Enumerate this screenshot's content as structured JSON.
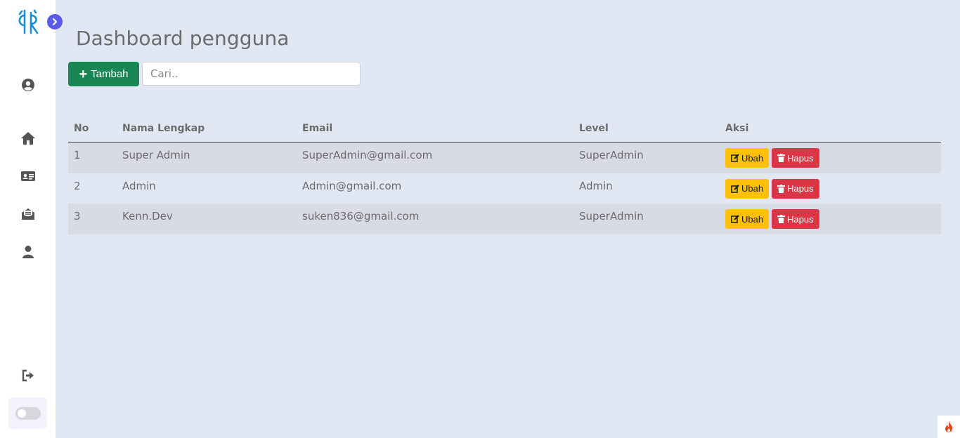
{
  "page": {
    "title": "Dashboard pengguna"
  },
  "toolbar": {
    "add_label": "Tambah",
    "search_placeholder": "Cari.."
  },
  "table": {
    "headers": {
      "no": "No",
      "name": "Nama Lengkap",
      "email": "Email",
      "level": "Level",
      "action": "Aksi"
    },
    "rows": [
      {
        "no": "1",
        "name": "Super Admin",
        "email": "SuperAdmin@gmail.com",
        "level": "SuperAdmin",
        "edit": "Ubah",
        "delete": "Hapus"
      },
      {
        "no": "2",
        "name": "Admin",
        "email": "Admin@gmail.com",
        "level": "Admin",
        "edit": "Ubah",
        "delete": "Hapus"
      },
      {
        "no": "3",
        "name": "Kenn.Dev",
        "email": "suken836@gmail.com",
        "level": "SuperAdmin",
        "edit": "Ubah",
        "delete": "Hapus"
      }
    ]
  },
  "sidebar": {
    "icons": [
      "logo",
      "expand-icon",
      "user-circle-icon",
      "home-icon",
      "id-card-icon",
      "envelope-open-icon",
      "user-icon",
      "logout-icon",
      "theme-toggle"
    ]
  },
  "colors": {
    "background": "#e2e7f4",
    "sidebar": "#ffffff",
    "primary_add": "#198754",
    "edit": "#ffc107",
    "delete": "#dc3545",
    "accent": "#5b5bea",
    "logo": "#1a8fd6"
  }
}
